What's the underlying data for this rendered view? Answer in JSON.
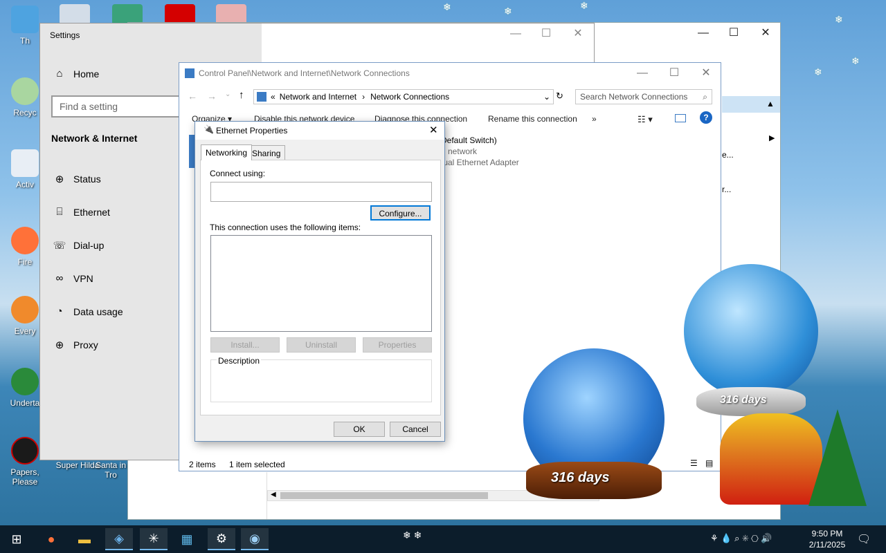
{
  "desktop": {
    "icons": [
      {
        "label": "Th"
      },
      {
        "label": "Recyc"
      },
      {
        "label": "Activ"
      },
      {
        "label": "Fire"
      },
      {
        "label": "Every"
      },
      {
        "label": "Underta"
      },
      {
        "label": "Papers, Please"
      },
      {
        "label": "Super Hilda"
      },
      {
        "label": "Santa in Tro"
      }
    ]
  },
  "back_window": {
    "fragment_1": "e...",
    "fragment_2": "r..."
  },
  "settings": {
    "title": "Settings",
    "home": "Home",
    "search_placeholder": "Find a setting",
    "section": "Network & Internet",
    "nav": [
      {
        "label": "Status",
        "icon": "globe-icon"
      },
      {
        "label": "Ethernet",
        "icon": "ethernet-icon"
      },
      {
        "label": "Dial-up",
        "icon": "dialup-icon"
      },
      {
        "label": "VPN",
        "icon": "vpn-icon"
      },
      {
        "label": "Data usage",
        "icon": "data-usage-icon"
      },
      {
        "label": "Proxy",
        "icon": "globe-icon"
      }
    ]
  },
  "netconn": {
    "title": "Control Panel\\Network and Internet\\Network Connections",
    "breadcrumb_1": "Network and Internet",
    "breadcrumb_2": "Network Connections",
    "search_placeholder": "Search Network Connections",
    "cmd_organize": "Organize ▾",
    "cmd_disable": "Disable this network device",
    "cmd_diagnose": "Diagnose this connection",
    "cmd_rename": "Rename this connection",
    "cmd_more": "»",
    "adapter_line1": "Default Switch)",
    "adapter_line2": "d network",
    "adapter_line3": "tual Ethernet Adapter",
    "status_items": "2 items",
    "status_selected": "1 item selected"
  },
  "dialog": {
    "title": "Ethernet Properties",
    "tab_networking": "Networking",
    "tab_sharing": "Sharing",
    "connect_using": "Connect using:",
    "connect_value": "",
    "configure": "Configure...",
    "items_label": "This connection uses the following items:",
    "install": "Install...",
    "uninstall": "Uninstall",
    "properties": "Properties",
    "description": "Description",
    "ok": "OK",
    "cancel": "Cancel"
  },
  "widgets": {
    "globe_big_days": "316 days",
    "globe_small_days": "316 days"
  },
  "taskbar": {
    "time": "9:50 PM",
    "date": "2/11/2025"
  },
  "colors": {
    "accent": "#0078d7",
    "taskbar": "#0c1d2b"
  }
}
